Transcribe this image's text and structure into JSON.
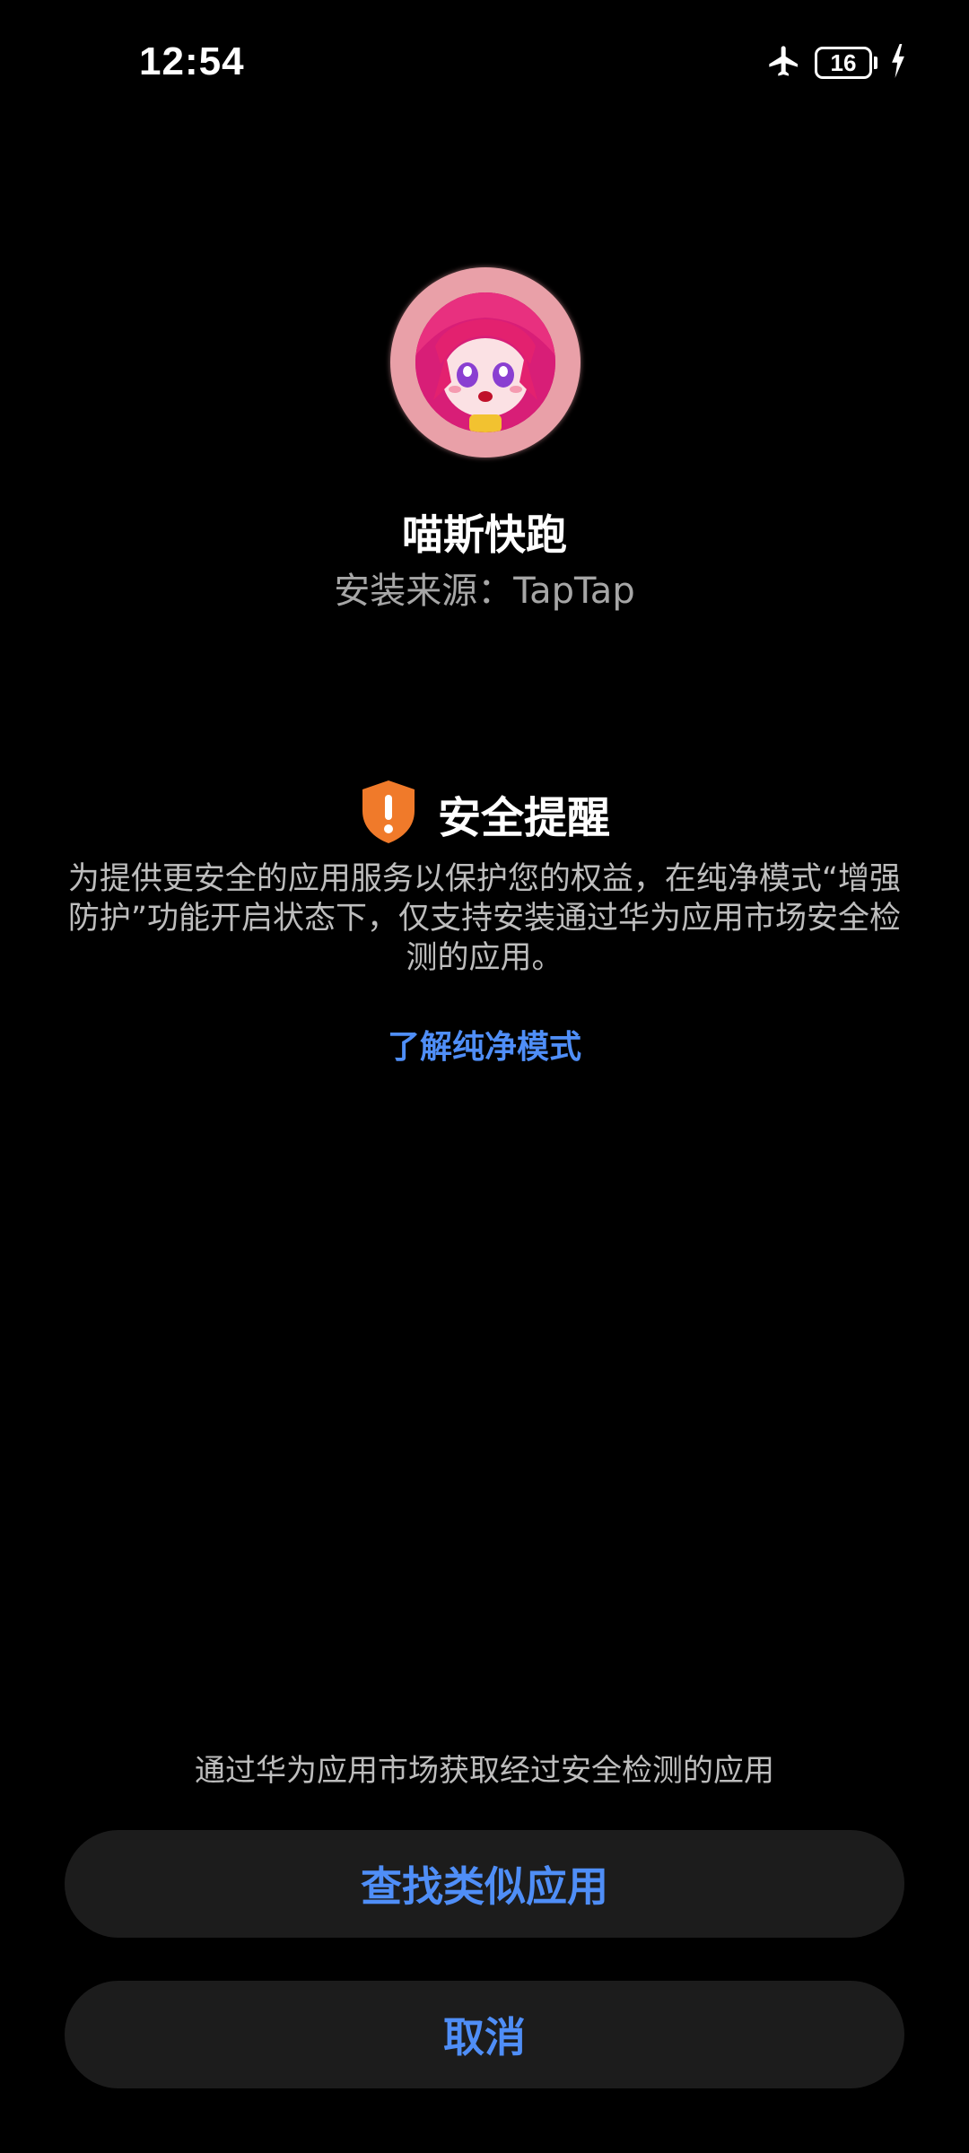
{
  "status_bar": {
    "time": "12:54",
    "battery_level": "16",
    "icons": [
      "airplane-mode-icon",
      "battery-icon",
      "charging-icon"
    ]
  },
  "app": {
    "name": "喵斯快跑",
    "source": "安装来源：TapTap"
  },
  "warning": {
    "title": "安全提醒",
    "icon": "shield-alert-icon",
    "body": "为提供更安全的应用服务以保护您的权益，在纯净模式“增强防护”功能开启状态下，仅支持安装通过华为应用市场安全检测的应用。",
    "learn_more": "了解纯净模式"
  },
  "bottom": {
    "hint": "通过华为应用市场获取经过安全检测的应用",
    "find_button": "查找类似应用",
    "cancel_button": "取消"
  },
  "colors": {
    "background": "#000000",
    "accent": "#4f8ef7",
    "warning_shield": "#f07a2a",
    "button_bg": "#1c1c1c",
    "secondary_text": "#a6a6a6"
  }
}
